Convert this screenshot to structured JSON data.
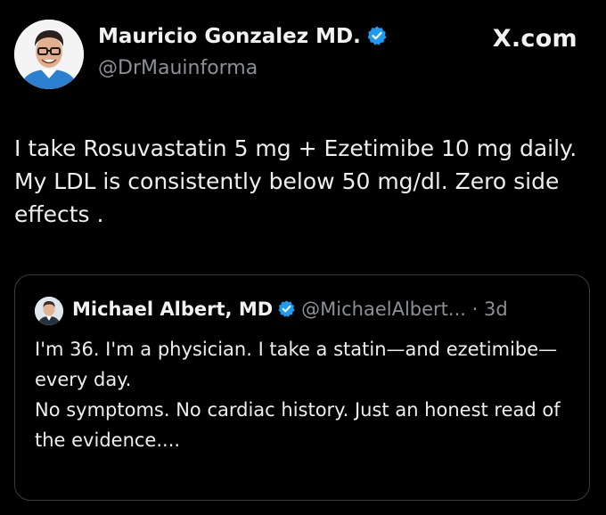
{
  "post": {
    "author_name": "Mauricio Gonzalez MD.",
    "author_handle": "@DrMauinforma",
    "brand": "X.com",
    "body": "I take Rosuvastatin 5 mg + Ezetimibe 10 mg daily. My LDL is consistently below 50 mg/dl. Zero side effects ."
  },
  "quote": {
    "author_name": "Michael Albert, MD",
    "author_handle": "@MichaelAlbert...",
    "separator": "·",
    "time": "3d",
    "paragraph1": "I'm 36. I'm a physician. I take a statin—and ezetimibe—every day.",
    "paragraph2": "No symptoms. No cardiac history. Just an honest read of the evidence...."
  },
  "colors": {
    "background": "#000000",
    "verified_blue": "#1d9bf0",
    "secondary_text": "#8b9096",
    "border": "#3a3d40"
  },
  "icons": [
    "avatar-photo",
    "verified-badge-icon",
    "x-logo"
  ]
}
